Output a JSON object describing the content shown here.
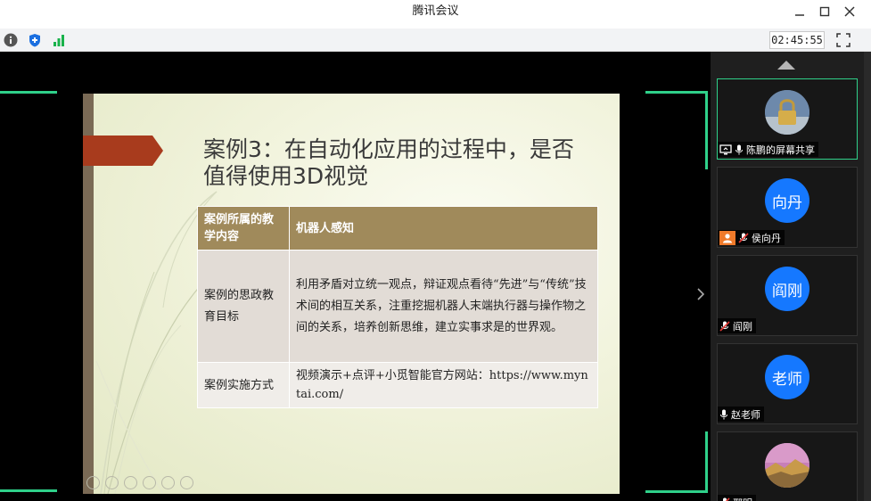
{
  "window": {
    "title": "腾讯会议"
  },
  "toolbar": {
    "timer": "02:45:55"
  },
  "slide": {
    "title": "案例3：在自动化应用的过程中，是否值得使用3D视觉",
    "table": {
      "header": [
        "案例所属的教学内容",
        "机器人感知"
      ],
      "rows": [
        [
          "案例的思政教育目标",
          "利用矛盾对立统一观点，辩证观点看待“先进”与“传统”技术间的相互关系，注重挖掘机器人末端执行器与操作物之间的关系，培养创新思维，建立实事求是的世界观。"
        ],
        [
          "案例实施方式",
          "视频演示+点评+小觅智能官方网站：https://www.myntai.com/"
        ]
      ]
    }
  },
  "participants": [
    {
      "name": "陈鹏的屏幕共享",
      "avatar": ""
    },
    {
      "name": "侯向丹",
      "avatar": "向丹"
    },
    {
      "name": "阎刚",
      "avatar": "阎刚"
    },
    {
      "name": "赵老师",
      "avatar": "老师"
    },
    {
      "name": "邢明",
      "avatar": ""
    }
  ],
  "colors": {
    "accent_green": "#2fd18a",
    "avatar_blue": "#1578ff",
    "table_header": "#a08a5b"
  }
}
